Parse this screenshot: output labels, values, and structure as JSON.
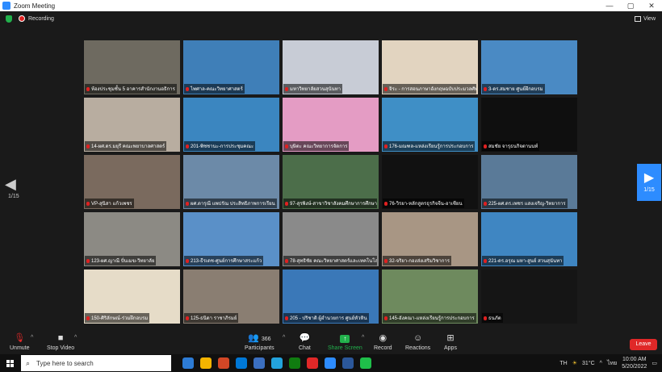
{
  "window": {
    "title": "Zoom Meeting",
    "controls": [
      "—",
      "▢",
      "✕"
    ]
  },
  "topbar": {
    "recording_label": "Recording",
    "view_label": "View"
  },
  "navigation": {
    "page_left": "1/15",
    "page_right": "1/15"
  },
  "participants": [
    {
      "name": "ห้องประชุมชั้น 5 อาคารสำนักงานอธิการ",
      "bg": "#6e6a60",
      "active": true
    },
    {
      "name": "ไพศาล-คณะวิทยาศาสตร์",
      "bg": "#3f7fb8"
    },
    {
      "name": "มหาวิทยาลัยสวนสุนันทา",
      "bg": "#c8ccd6"
    },
    {
      "name": "จิระ - การสอนภาษาอังกฤษฉบับประมวลศัพท์",
      "bg": "#e2d4c0"
    },
    {
      "name": "3-ดร.สมชาย ศูนย์ฝึกอบรม",
      "bg": "#4a8ac4"
    },
    {
      "name": "14-ผศ.ดร.มยุรี คณะพยาบาลศาสตร์",
      "bg": "#b8ada0"
    },
    {
      "name": "201-พิชชานะ-การประชุมคณะ",
      "bg": "#3b86c0"
    },
    {
      "name": "บุษิตะ คณะวิทยาการจัดการ",
      "bg": "#e49cc4"
    },
    {
      "name": "176-มณฑล-แหล่งเรียนรู้การประกอบการ",
      "bg": "#3f8fc6"
    },
    {
      "name": "สมชัย จารุธนกิจตานนท์",
      "bg": "#0f0f0f"
    },
    {
      "name": "VP-สุนิสา แก้วเพชร",
      "bg": "#7a6a5e"
    },
    {
      "name": "ผศ.ดารุณี แพปรัณ ประสิทธิภาพการเรียน",
      "bg": "#6c8aa8"
    },
    {
      "name": "97-สุรพิงษ์-สาขาวิชาสังคมศึกษาการศึกษา",
      "bg": "#4c6e4a"
    },
    {
      "name": "76-วิรยา-หลักสูตรธุรกิจจีน-อาเซียน",
      "bg": "#111111"
    },
    {
      "name": "225-ผศ.ดร.เพชร แสงเจริญ-วิทยาการ",
      "bg": "#5a7a98"
    },
    {
      "name": "123-ผศ.ญาณี ปั่นเมฆ-วิทยาลัย",
      "bg": "#8c8a84"
    },
    {
      "name": "213-ธีรเดช-ศูนย์การศึกษาสระแก้ว",
      "bg": "#5a90c8"
    },
    {
      "name": "78-สุทธิชัย คณะวิทยาศาสตร์และเทคโนโลยี",
      "bg": "#8a8a8a"
    },
    {
      "name": "32-จริยา-กองส่งเสริมวิชาการ",
      "bg": "#a89684"
    },
    {
      "name": "221-ดร.อรุณ มหา-สูนย์ สวนสุนันทา",
      "bg": "#3f86c2"
    },
    {
      "name": "150-ศิริลักษณ์-ร่วมฝึกอบรม",
      "bg": "#e6dcc8"
    },
    {
      "name": "125-ธนิดา ราชาภิรมย์",
      "bg": "#8a7e72"
    },
    {
      "name": "205 - ปริชาติ ผู้อำนวยการ ศูนย์หัวหิน",
      "bg": "#3a78b8"
    },
    {
      "name": "145-อังคณา-แหล่งเรียนรู้การประกอบการ",
      "bg": "#6e8a5e"
    },
    {
      "name": "ธนภัต",
      "bg": "#151515"
    }
  ],
  "toolbar": {
    "unmute": "Unmute",
    "stop_video": "Stop Video",
    "participants": "Participants",
    "participant_count": "366",
    "chat": "Chat",
    "share_screen": "Share Screen",
    "record": "Record",
    "reactions": "Reactions",
    "apps": "Apps",
    "leave": "Leave"
  },
  "taskbar": {
    "search_placeholder": "Type here to search",
    "lang": "TH",
    "temperature": "31°C",
    "ime": "ไทย",
    "time": "10:00 AM",
    "date": "5/20/2022",
    "app_colors": [
      "#2d7cd6",
      "#f4b400",
      "#d24726",
      "#0078d7",
      "#3b6fc0",
      "#23a3dd",
      "#107c10",
      "#e02828",
      "#2d8cff",
      "#2b579a",
      "#1fbf4a"
    ]
  }
}
